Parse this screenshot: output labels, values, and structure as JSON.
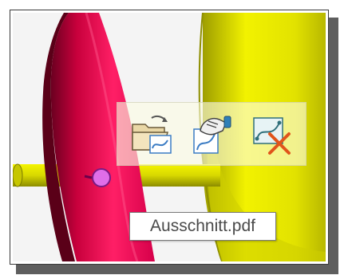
{
  "tooltip": {
    "text": "Ausschnitt.pdf"
  },
  "toolbar": {
    "tools": [
      {
        "icon": "open-folder-curve-icon"
      },
      {
        "icon": "hand-curve-icon"
      },
      {
        "icon": "delete-curve-icon"
      }
    ]
  },
  "colors": {
    "magenta_part": "#e6004f",
    "yellow_part": "#e8e600",
    "point_marker": "#e06ee8",
    "toolbar_bg": "#fcfce4",
    "delete_cross": "#e0541b"
  }
}
